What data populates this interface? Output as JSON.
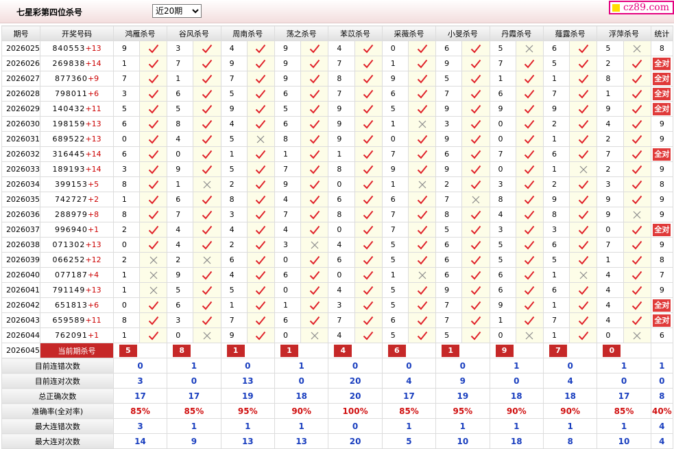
{
  "header": {
    "title": "七星彩第四位杀号",
    "period_select": {
      "value": "近20期",
      "options": [
        "近20期"
      ]
    },
    "logo_text": "cz89.com"
  },
  "columns": {
    "issue": "期号",
    "numbers": "开奖号码",
    "experts": [
      "鸿雁杀号",
      "谷风杀号",
      "周南杀号",
      "荡之杀号",
      "苯苡杀号",
      "采薇杀号",
      "小旻杀号",
      "丹霞杀号",
      "薤露杀号",
      "浮萍杀号"
    ],
    "stat": "统计"
  },
  "rows": [
    {
      "issue": "2026025",
      "balls": "840553",
      "plus": "+13",
      "picks": [
        9,
        3,
        4,
        9,
        4,
        0,
        6,
        5,
        6,
        5
      ],
      "hits": [
        1,
        1,
        1,
        1,
        1,
        1,
        1,
        0,
        1,
        0
      ],
      "stat": "8"
    },
    {
      "issue": "2026026",
      "balls": "269838",
      "plus": "+14",
      "picks": [
        1,
        7,
        9,
        9,
        7,
        1,
        9,
        7,
        5,
        2
      ],
      "hits": [
        1,
        1,
        1,
        1,
        1,
        1,
        1,
        1,
        1,
        1
      ],
      "stat": "全对"
    },
    {
      "issue": "2026027",
      "balls": "877360",
      "plus": "+9",
      "picks": [
        7,
        1,
        7,
        9,
        8,
        9,
        5,
        1,
        1,
        8
      ],
      "hits": [
        1,
        1,
        1,
        1,
        1,
        1,
        1,
        1,
        1,
        1
      ],
      "stat": "全对"
    },
    {
      "issue": "2026028",
      "balls": "798011",
      "plus": "+6",
      "picks": [
        3,
        6,
        5,
        6,
        7,
        6,
        7,
        6,
        7,
        1
      ],
      "hits": [
        1,
        1,
        1,
        1,
        1,
        1,
        1,
        1,
        1,
        1
      ],
      "stat": "全对"
    },
    {
      "issue": "2026029",
      "balls": "140432",
      "plus": "+11",
      "picks": [
        5,
        5,
        9,
        5,
        9,
        5,
        9,
        9,
        9,
        9
      ],
      "hits": [
        1,
        1,
        1,
        1,
        1,
        1,
        1,
        1,
        1,
        1
      ],
      "stat": "全对"
    },
    {
      "issue": "2026030",
      "balls": "198159",
      "plus": "+13",
      "picks": [
        6,
        8,
        4,
        6,
        9,
        1,
        3,
        0,
        2,
        4
      ],
      "hits": [
        1,
        1,
        1,
        1,
        1,
        0,
        1,
        1,
        1,
        1
      ],
      "stat": "9"
    },
    {
      "issue": "2026031",
      "balls": "689522",
      "plus": "+13",
      "picks": [
        0,
        4,
        5,
        8,
        9,
        0,
        9,
        0,
        1,
        2
      ],
      "hits": [
        1,
        1,
        0,
        1,
        1,
        1,
        1,
        1,
        1,
        1
      ],
      "stat": "9"
    },
    {
      "issue": "2026032",
      "balls": "316445",
      "plus": "+14",
      "picks": [
        6,
        0,
        1,
        1,
        1,
        7,
        6,
        7,
        6,
        7
      ],
      "hits": [
        1,
        1,
        1,
        1,
        1,
        1,
        1,
        1,
        1,
        1
      ],
      "stat": "全对"
    },
    {
      "issue": "2026033",
      "balls": "189193",
      "plus": "+14",
      "picks": [
        3,
        9,
        5,
        7,
        8,
        9,
        9,
        0,
        1,
        2
      ],
      "hits": [
        1,
        1,
        1,
        1,
        1,
        1,
        1,
        1,
        0,
        1
      ],
      "stat": "9"
    },
    {
      "issue": "2026034",
      "balls": "399153",
      "plus": "+5",
      "picks": [
        8,
        1,
        2,
        9,
        0,
        1,
        2,
        3,
        2,
        3
      ],
      "hits": [
        1,
        0,
        1,
        1,
        1,
        0,
        1,
        1,
        1,
        1
      ],
      "stat": "8"
    },
    {
      "issue": "2026035",
      "balls": "742727",
      "plus": "+2",
      "picks": [
        1,
        6,
        8,
        4,
        6,
        6,
        7,
        8,
        9,
        9
      ],
      "hits": [
        1,
        1,
        1,
        1,
        1,
        1,
        0,
        1,
        1,
        1
      ],
      "stat": "9"
    },
    {
      "issue": "2026036",
      "balls": "288979",
      "plus": "+8",
      "picks": [
        8,
        7,
        3,
        7,
        8,
        7,
        8,
        4,
        8,
        9
      ],
      "hits": [
        1,
        1,
        1,
        1,
        1,
        1,
        1,
        1,
        1,
        0
      ],
      "stat": "9"
    },
    {
      "issue": "2026037",
      "balls": "996940",
      "plus": "+1",
      "picks": [
        2,
        4,
        4,
        4,
        0,
        7,
        5,
        3,
        3,
        0
      ],
      "hits": [
        1,
        1,
        1,
        1,
        1,
        1,
        1,
        1,
        1,
        1
      ],
      "stat": "全对"
    },
    {
      "issue": "2026038",
      "balls": "071302",
      "plus": "+13",
      "picks": [
        0,
        4,
        2,
        3,
        4,
        5,
        6,
        5,
        6,
        7
      ],
      "hits": [
        1,
        1,
        1,
        0,
        1,
        1,
        1,
        1,
        1,
        1
      ],
      "stat": "9"
    },
    {
      "issue": "2026039",
      "balls": "066252",
      "plus": "+12",
      "picks": [
        2,
        2,
        6,
        0,
        6,
        5,
        6,
        5,
        5,
        1
      ],
      "hits": [
        0,
        0,
        1,
        1,
        1,
        1,
        1,
        1,
        1,
        1
      ],
      "stat": "8"
    },
    {
      "issue": "2026040",
      "balls": "077187",
      "plus": "+4",
      "picks": [
        1,
        9,
        4,
        6,
        0,
        1,
        6,
        6,
        1,
        4
      ],
      "hits": [
        0,
        1,
        1,
        1,
        1,
        0,
        1,
        1,
        0,
        1
      ],
      "stat": "7"
    },
    {
      "issue": "2026041",
      "balls": "791149",
      "plus": "+13",
      "picks": [
        1,
        5,
        5,
        0,
        4,
        5,
        9,
        6,
        6,
        4
      ],
      "hits": [
        0,
        1,
        1,
        1,
        1,
        1,
        1,
        1,
        1,
        1
      ],
      "stat": "9"
    },
    {
      "issue": "2026042",
      "balls": "651813",
      "plus": "+6",
      "picks": [
        0,
        6,
        1,
        1,
        3,
        5,
        7,
        9,
        1,
        4
      ],
      "hits": [
        1,
        1,
        1,
        1,
        1,
        1,
        1,
        1,
        1,
        1
      ],
      "stat": "全对"
    },
    {
      "issue": "2026043",
      "balls": "659589",
      "plus": "+11",
      "picks": [
        8,
        3,
        7,
        6,
        7,
        6,
        7,
        1,
        7,
        4
      ],
      "hits": [
        1,
        1,
        1,
        1,
        1,
        1,
        1,
        1,
        1,
        1
      ],
      "stat": "全对"
    },
    {
      "issue": "2026044",
      "balls": "762091",
      "plus": "+1",
      "picks": [
        1,
        0,
        9,
        0,
        4,
        5,
        5,
        0,
        1,
        0
      ],
      "hits": [
        1,
        0,
        1,
        0,
        1,
        1,
        1,
        0,
        1,
        0
      ],
      "stat": "6"
    }
  ],
  "current": {
    "issue": "2026045",
    "label": "当前期杀号",
    "picks": [
      "5",
      "8",
      "1",
      "1",
      "4",
      "6",
      "1",
      "9",
      "7",
      "0"
    ]
  },
  "summary": [
    {
      "label": "目前连错次数",
      "values": [
        "0",
        "1",
        "0",
        "1",
        "0",
        "0",
        "0",
        "1",
        "0",
        "1"
      ],
      "stat": "1"
    },
    {
      "label": "目前连对次数",
      "values": [
        "3",
        "0",
        "13",
        "0",
        "20",
        "4",
        "9",
        "0",
        "4",
        "0"
      ],
      "stat": "0"
    },
    {
      "label": "总正确次数",
      "values": [
        "17",
        "17",
        "19",
        "18",
        "20",
        "17",
        "19",
        "18",
        "18",
        "17"
      ],
      "stat": "8"
    },
    {
      "label": "准确率(全对率)",
      "values": [
        "85%",
        "85%",
        "95%",
        "90%",
        "100%",
        "85%",
        "95%",
        "90%",
        "90%",
        "85%"
      ],
      "stat": "40%",
      "rate": true
    },
    {
      "label": "最大连错次数",
      "values": [
        "3",
        "1",
        "1",
        "1",
        "0",
        "1",
        "1",
        "1",
        "1",
        "1"
      ],
      "stat": "4"
    },
    {
      "label": "最大连对次数",
      "values": [
        "14",
        "9",
        "13",
        "13",
        "20",
        "5",
        "10",
        "18",
        "8",
        "10"
      ],
      "stat": "4"
    }
  ],
  "colors": {
    "check": "#e0222a",
    "cross": "#8a8a8a",
    "badge": "#e03a3a",
    "current": "#c62828",
    "blue": "#1a3fbf",
    "red": "#d01010"
  },
  "icons": {
    "hit": "check-icon",
    "miss": "cross-icon"
  }
}
